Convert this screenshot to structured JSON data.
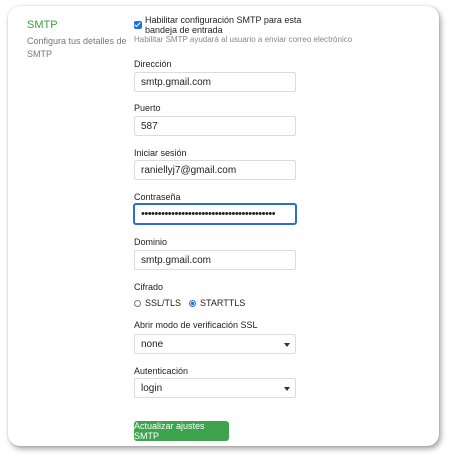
{
  "sidebar": {
    "title": "SMTP",
    "description": "Configura tus detalles de SMTP"
  },
  "enable": {
    "label": "Habilitar configuración SMTP para esta bandeja de entrada",
    "checked": true,
    "hint": "Habilitar SMTP ayudará al usuario a enviar correo electrónico"
  },
  "fields": {
    "address": {
      "label": "Dirección",
      "value": "smtp.gmail.com"
    },
    "port": {
      "label": "Puerto",
      "value": "587"
    },
    "login": {
      "label": "Iniciar sesión",
      "value": "raniellyj7@gmail.com"
    },
    "password": {
      "label": "Contraseña",
      "value": "••••••••••••••••••••••••••••••••••••••••"
    },
    "domain": {
      "label": "Dominio",
      "value": "smtp.gmail.com"
    }
  },
  "encryption": {
    "label": "Cifrado",
    "options": [
      "SSL/TLS",
      "STARTTLS"
    ],
    "selected": "STARTTLS"
  },
  "ssl_verify": {
    "label": "Abrir modo de verificación SSL",
    "value": "none"
  },
  "authentication": {
    "label": "Autenticación",
    "value": "login"
  },
  "submit": {
    "label": "Actualizar ajustes SMTP"
  },
  "colors": {
    "accent": "#3fa34d",
    "focus": "#2a6fd0"
  }
}
